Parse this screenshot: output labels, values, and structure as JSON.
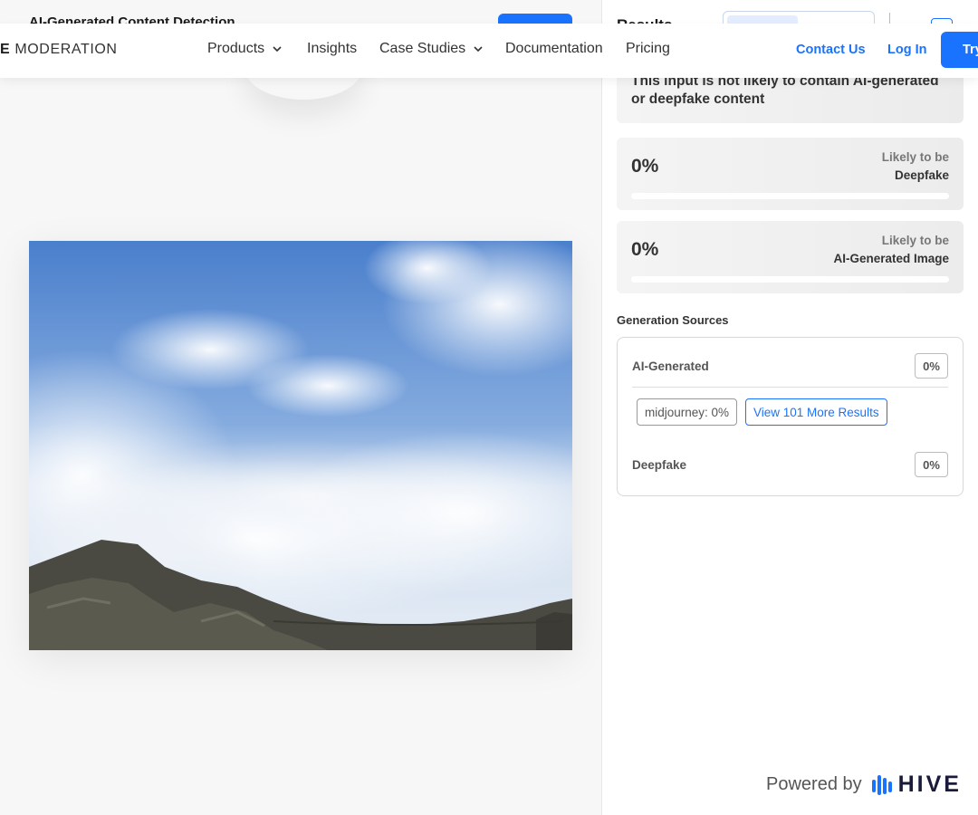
{
  "page": {
    "title": "AI-Generated Content Detection"
  },
  "nav": {
    "brand_partial": "E",
    "brand_rest": "MODERATION",
    "items": [
      {
        "label": "Products",
        "has_dropdown": true
      },
      {
        "label": "Insights",
        "has_dropdown": false
      },
      {
        "label": "Case Studies",
        "has_dropdown": true
      },
      {
        "label": "Documentation",
        "has_dropdown": false
      },
      {
        "label": "Pricing",
        "has_dropdown": false
      }
    ],
    "contact_label": "Contact Us",
    "login_label": "Log In",
    "try_label": "Try"
  },
  "results": {
    "title": "Results",
    "summary_prefix": "This input is ",
    "summary_bold": "not likely to contain AI-generated or deepfake content",
    "scores": [
      {
        "percent_label": "0%",
        "likely_label": "Likely to be",
        "category": "Deepfake",
        "value": 0
      },
      {
        "percent_label": "0%",
        "likely_label": "Likely to be",
        "category": "AI-Generated Image",
        "value": 0
      }
    ]
  },
  "generation_sources": {
    "title": "Generation Sources",
    "ai_generated": {
      "label": "AI-Generated",
      "percent": "0%"
    },
    "sources": [
      {
        "label": "midjourney: 0%"
      }
    ],
    "more_label": "View 101 More Results",
    "deepfake": {
      "label": "Deepfake",
      "percent": "0%"
    }
  },
  "footer": {
    "powered_label": "Powered by",
    "logo_word": "HIVE"
  },
  "colors": {
    "accent": "#1a73ff",
    "sky_top": "#4f84d0",
    "rocks": "#4a4a42"
  },
  "icons": [
    "chevron-down-icon",
    "hive-logo-icon",
    "copy-icon"
  ]
}
